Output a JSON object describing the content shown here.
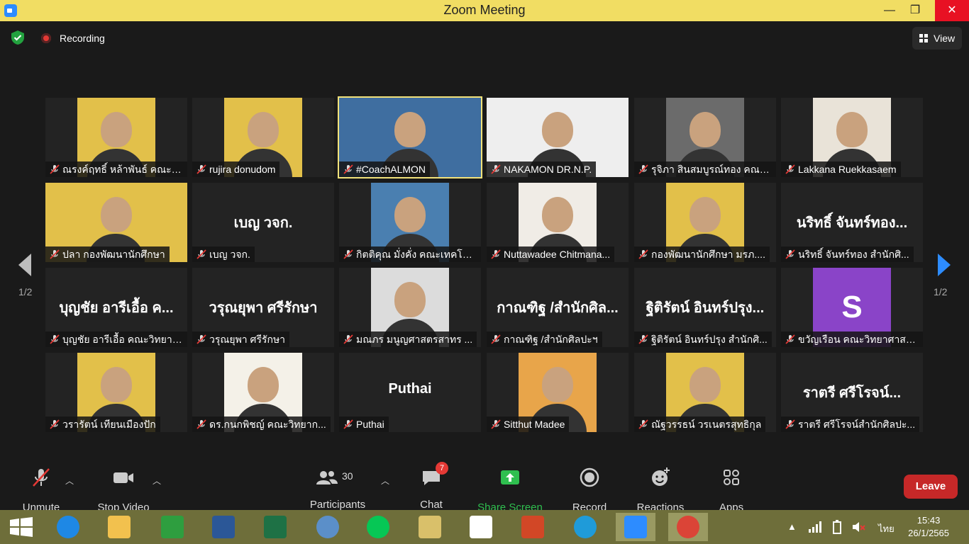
{
  "window": {
    "title": "Zoom Meeting"
  },
  "topbar": {
    "recording_label": "Recording",
    "view_label": "View"
  },
  "gallery": {
    "page_left": "1/2",
    "page_right": "1/2",
    "tiles": [
      {
        "name": "ณรงค์ฤทธิ์ หล้าพันธ์ คณะว...",
        "kind": "photo",
        "bg": "#e2c04a"
      },
      {
        "name": "rujira donudom",
        "kind": "photo",
        "bg": "#e2c04a"
      },
      {
        "name": "#CoachALMON",
        "kind": "photo-wide",
        "bg": "#3f6ea0",
        "active": true
      },
      {
        "name": "NAKAMON DR.N.P.",
        "kind": "photo-wide",
        "bg": "#eeeeee"
      },
      {
        "name": "รุจิภา สินสมบูรณ์ทอง คณะ...",
        "kind": "photo",
        "bg": "#6b6b6b"
      },
      {
        "name": "Lakkana Ruekkasaem",
        "kind": "photo",
        "bg": "#e9e3d8"
      },
      {
        "name": "ปลา กองพัฒนานักศึกษา",
        "kind": "photo-wide",
        "bg": "#e2c04a"
      },
      {
        "name": "เบญ วจก.",
        "kind": "text",
        "big": "เบญ วจก."
      },
      {
        "name": "กิตติคุณ มั่งคั่ง คณะเทคโนโ...",
        "kind": "photo",
        "bg": "#4a7fb0"
      },
      {
        "name": "Nuttawadee Chitmana...",
        "kind": "photo",
        "bg": "#f0ece6"
      },
      {
        "name": "กองพัฒนานักศึกษา มรภ....",
        "kind": "photo",
        "bg": "#e2c04a"
      },
      {
        "name": "นริทธิ์ จันทร์ทอง สำนักศิ...",
        "kind": "text",
        "big": "นริทธิ์ จันทร์ทอง..."
      },
      {
        "name": "บุญชัย อารีเอื้อ คณะวิทยาศ...",
        "kind": "text",
        "big": "บุญชัย อารีเอื้อ ค..."
      },
      {
        "name": "วรุณยุพา ศรีรักษา",
        "kind": "text",
        "big": "วรุณยุพา ศรีรักษา"
      },
      {
        "name": "มณภร มนูญศาสตรสาทร ...",
        "kind": "photo",
        "bg": "#dcdcdc"
      },
      {
        "name": "กาณฑิฐ /สำนักศิลปะฯ",
        "kind": "text",
        "big": "กาณฑิฐ /สำนักศิล..."
      },
      {
        "name": "ฐิติรัตน์ อินทร์ปรุง สำนักศิ...",
        "kind": "text",
        "big": "ฐิติรัตน์ อินทร์ปรุง..."
      },
      {
        "name": "ขวัญเรือน คณะวิทยาศาสต...",
        "kind": "avatar",
        "letter": "S"
      },
      {
        "name": "วรารัตน์ เทียนเมืองปัก",
        "kind": "photo",
        "bg": "#e2c04a"
      },
      {
        "name": "ดร.กนกพิชญ์ คณะวิทยาก...",
        "kind": "photo",
        "bg": "#f4f1e8"
      },
      {
        "name": "Puthai",
        "kind": "text",
        "big": "Puthai"
      },
      {
        "name": "Sitthut Madee",
        "kind": "photo",
        "bg": "#e8a54a"
      },
      {
        "name": "ณัฐวรรธน์ วรเนตรสุทธิกุล",
        "kind": "photo",
        "bg": "#e2c04a"
      },
      {
        "name": "ราตรี ศรีโรจน์สำนักศิลปะ...",
        "kind": "text",
        "big": "ราตรี   ศรีโรจน์..."
      }
    ]
  },
  "toolbar": {
    "unmute": "Unmute",
    "stop_video": "Stop Video",
    "participants": "Participants",
    "participants_count": "30",
    "chat": "Chat",
    "chat_badge": "7",
    "share": "Share Screen",
    "record": "Record",
    "reactions": "Reactions",
    "apps": "Apps",
    "leave": "Leave"
  },
  "taskbar": {
    "time": "15:43",
    "date": "26/1/2565",
    "lang": "ไทย",
    "apps": [
      {
        "name": "internet-explorer-icon",
        "color": "#1e88e5"
      },
      {
        "name": "file-explorer-icon",
        "color": "#f2c14e"
      },
      {
        "name": "store-icon",
        "color": "#2e9e3f"
      },
      {
        "name": "word-icon",
        "color": "#2b5797"
      },
      {
        "name": "excel-icon",
        "color": "#1e7145"
      },
      {
        "name": "math-icon",
        "color": "#5b8fc9"
      },
      {
        "name": "line-icon",
        "color": "#06c755"
      },
      {
        "name": "paint-icon",
        "color": "#d9c06a"
      },
      {
        "name": "lisrel-icon",
        "color": "#ffffff"
      },
      {
        "name": "powerpoint-icon",
        "color": "#d24726"
      },
      {
        "name": "edge-icon",
        "color": "#1f9bd9"
      },
      {
        "name": "zoom-icon",
        "color": "#2d8cff"
      },
      {
        "name": "chrome-icon",
        "color": "#db4437"
      }
    ]
  }
}
